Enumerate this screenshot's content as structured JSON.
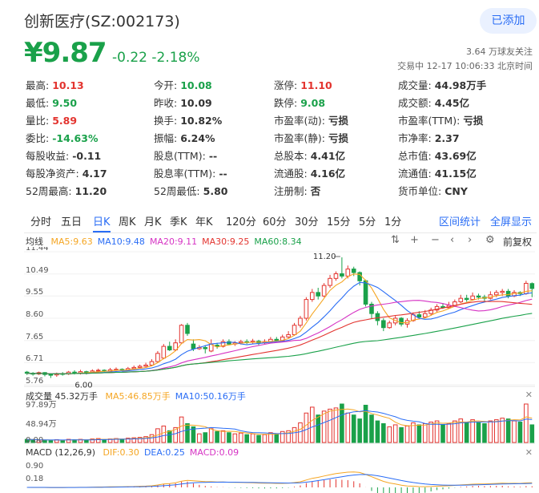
{
  "header": {
    "title": "创新医疗(SZ:002173)",
    "added_label": "已添加",
    "price": "¥9.87",
    "change": "-0.22 -2.18%",
    "followers": "3.64 万球友关注",
    "trading_status": "交易中 12-17 10:06:33 北京时间"
  },
  "quote": [
    [
      {
        "label": "最高:",
        "value": "10.13",
        "color": "red"
      },
      {
        "label": "今开:",
        "value": "10.08",
        "color": "green"
      },
      {
        "label": "涨停:",
        "value": "11.10",
        "color": "red"
      },
      {
        "label": "成交量:",
        "value": "44.98万手",
        "color": ""
      }
    ],
    [
      {
        "label": "最低:",
        "value": "9.50",
        "color": "green"
      },
      {
        "label": "昨收:",
        "value": "10.09",
        "color": ""
      },
      {
        "label": "跌停:",
        "value": "9.08",
        "color": "green"
      },
      {
        "label": "成交额:",
        "value": "4.45亿",
        "color": ""
      }
    ],
    [
      {
        "label": "量比:",
        "value": "5.89",
        "color": "red"
      },
      {
        "label": "换手:",
        "value": "10.82%",
        "color": ""
      },
      {
        "label": "市盈率(动):",
        "value": "亏损",
        "color": ""
      },
      {
        "label": "市盈率(TTM):",
        "value": "亏损",
        "color": ""
      }
    ],
    [
      {
        "label": "委比:",
        "value": "-14.63%",
        "color": "green"
      },
      {
        "label": "振幅:",
        "value": "6.24%",
        "color": ""
      },
      {
        "label": "市盈率(静):",
        "value": "亏损",
        "color": ""
      },
      {
        "label": "市净率:",
        "value": "2.37",
        "color": ""
      }
    ],
    [
      {
        "label": "每股收益:",
        "value": "-0.11",
        "color": ""
      },
      {
        "label": "股息(TTM):",
        "value": "--",
        "color": ""
      },
      {
        "label": "总股本:",
        "value": "4.41亿",
        "color": ""
      },
      {
        "label": "总市值:",
        "value": "43.69亿",
        "color": ""
      }
    ],
    [
      {
        "label": "每股净资产:",
        "value": "4.17",
        "color": ""
      },
      {
        "label": "股息率(TTM):",
        "value": "--",
        "color": ""
      },
      {
        "label": "流通股:",
        "value": "4.16亿",
        "color": ""
      },
      {
        "label": "流通值:",
        "value": "41.15亿",
        "color": ""
      }
    ],
    [
      {
        "label": "52周最高:",
        "value": "11.20",
        "color": ""
      },
      {
        "label": "52周最低:",
        "value": "5.80",
        "color": ""
      },
      {
        "label": "注册制:",
        "value": "否",
        "color": ""
      },
      {
        "label": "货币单位:",
        "value": "CNY",
        "color": ""
      }
    ]
  ],
  "tabs": [
    "分时",
    "五日",
    "日K",
    "周K",
    "月K",
    "季K",
    "年K",
    "120分",
    "60分",
    "30分",
    "15分",
    "5分",
    "1分"
  ],
  "active_tab": "日K",
  "tab_links": {
    "range_stats": "区间统计",
    "fullscreen": "全屏显示"
  },
  "kline": {
    "legend_title": "均线",
    "ma": [
      {
        "label": "MA5:9.63",
        "color": "#f5a623"
      },
      {
        "label": "MA10:9.48",
        "color": "#2a6df5"
      },
      {
        "label": "MA20:9.11",
        "color": "#d633c4"
      },
      {
        "label": "MA30:9.25",
        "color": "#e3342f"
      },
      {
        "label": "MA60:8.34",
        "color": "#1aa14a"
      }
    ],
    "restore_label": "前复权",
    "y_ticks": [
      "11.44",
      "10.49",
      "9.55",
      "8.60",
      "7.65",
      "6.71",
      "5.76"
    ],
    "y_tick_values": [
      11.44,
      10.49,
      9.55,
      8.6,
      7.65,
      6.71,
      5.76
    ],
    "high_label": "11.20",
    "low_label": "6.00"
  },
  "volume": {
    "title": "成交量 45.32万手",
    "ma": [
      {
        "label": "MA5:46.85万手",
        "color": "#f5a623"
      },
      {
        "label": "MA10:50.16万手",
        "color": "#2a6df5"
      }
    ],
    "y_ticks": [
      "97.89万",
      "48.94万",
      "0.00"
    ]
  },
  "macd": {
    "title": "MACD (12,26,9)",
    "items": [
      {
        "label": "DIF:0.30",
        "color": "#f5a623"
      },
      {
        "label": "DEA:0.25",
        "color": "#2a6df5"
      },
      {
        "label": "MACD:0.09",
        "color": "#d633c4"
      }
    ],
    "y_ticks": [
      "0.90",
      "0.18"
    ]
  },
  "colors": {
    "up": "#e3342f",
    "down": "#1aa14a",
    "accent": "#2a6df5"
  },
  "chart_data": {
    "type": "candlestick",
    "y_range": [
      5.76,
      11.44
    ],
    "candles": [
      [
        6.3,
        6.25,
        6.35,
        6.18
      ],
      [
        6.25,
        6.22,
        6.3,
        6.15
      ],
      [
        6.22,
        6.28,
        6.32,
        6.18
      ],
      [
        6.28,
        6.2,
        6.3,
        6.12
      ],
      [
        6.2,
        6.18,
        6.25,
        6.05
      ],
      [
        6.18,
        6.24,
        6.28,
        6.1
      ],
      [
        6.24,
        6.22,
        6.3,
        6.15
      ],
      [
        6.22,
        6.3,
        6.35,
        6.18
      ],
      [
        6.3,
        6.25,
        6.38,
        6.2
      ],
      [
        6.25,
        6.32,
        6.4,
        6.2
      ],
      [
        6.32,
        6.28,
        6.36,
        6.2
      ],
      [
        6.28,
        6.35,
        6.42,
        6.25
      ],
      [
        6.35,
        6.38,
        6.45,
        6.3
      ],
      [
        6.38,
        6.34,
        6.42,
        6.28
      ],
      [
        6.34,
        6.4,
        6.48,
        6.3
      ],
      [
        6.4,
        6.42,
        6.5,
        6.35
      ],
      [
        6.42,
        6.38,
        6.46,
        6.32
      ],
      [
        6.38,
        6.45,
        6.52,
        6.34
      ],
      [
        6.45,
        6.5,
        6.58,
        6.4
      ],
      [
        6.5,
        6.55,
        6.62,
        6.45
      ],
      [
        6.55,
        6.6,
        6.7,
        6.5
      ],
      [
        6.6,
        6.75,
        6.85,
        6.55
      ],
      [
        6.75,
        7.1,
        7.2,
        6.7
      ],
      [
        6.9,
        7.4,
        7.5,
        6.85
      ],
      [
        7.4,
        7.25,
        7.6,
        7.2
      ],
      [
        7.25,
        7.55,
        7.7,
        7.2
      ],
      [
        7.55,
        8.3,
        8.35,
        7.5
      ],
      [
        8.3,
        7.95,
        8.4,
        7.85
      ],
      [
        7.5,
        7.3,
        7.7,
        7.2
      ],
      [
        7.3,
        7.35,
        7.45,
        7.25
      ],
      [
        7.35,
        7.3,
        7.45,
        7.1
      ],
      [
        7.2,
        7.5,
        7.7,
        7.15
      ],
      [
        7.45,
        7.4,
        7.55,
        7.3
      ],
      [
        7.4,
        7.6,
        7.7,
        7.35
      ],
      [
        7.6,
        7.5,
        7.7,
        7.45
      ],
      [
        7.5,
        7.55,
        7.62,
        7.42
      ],
      [
        7.55,
        7.6,
        7.68,
        7.48
      ],
      [
        7.6,
        7.58,
        7.7,
        7.5
      ],
      [
        7.58,
        7.62,
        7.72,
        7.5
      ],
      [
        7.62,
        7.55,
        7.68,
        7.45
      ],
      [
        7.55,
        7.6,
        7.7,
        7.5
      ],
      [
        7.6,
        7.7,
        7.8,
        7.55
      ],
      [
        7.7,
        7.65,
        7.8,
        7.58
      ],
      [
        7.65,
        7.8,
        7.9,
        7.6
      ],
      [
        7.8,
        7.9,
        8.05,
        7.75
      ],
      [
        7.9,
        8.3,
        8.4,
        7.85
      ],
      [
        8.3,
        8.6,
        8.7,
        8.2
      ],
      [
        8.6,
        9.4,
        9.5,
        8.5
      ],
      [
        9.4,
        9.7,
        9.85,
        9.3
      ],
      [
        9.7,
        9.55,
        9.9,
        9.4
      ],
      [
        9.55,
        10.0,
        10.1,
        9.5
      ],
      [
        10.0,
        10.3,
        10.45,
        9.9
      ],
      [
        10.3,
        10.5,
        10.6,
        10.2
      ],
      [
        10.5,
        10.4,
        11.2,
        10.3
      ],
      [
        10.4,
        10.7,
        10.85,
        10.3
      ],
      [
        10.7,
        10.55,
        10.8,
        10.4
      ],
      [
        10.55,
        10.2,
        10.6,
        10.0
      ],
      [
        10.2,
        9.2,
        10.25,
        9.1
      ],
      [
        9.2,
        8.8,
        9.3,
        8.6
      ],
      [
        8.8,
        8.5,
        8.9,
        8.3
      ],
      [
        8.5,
        8.2,
        8.6,
        8.05
      ],
      [
        8.2,
        8.4,
        8.5,
        8.15
      ],
      [
        8.4,
        8.6,
        8.7,
        8.3
      ],
      [
        8.6,
        8.35,
        8.65,
        8.25
      ],
      [
        8.35,
        8.5,
        8.6,
        8.2
      ],
      [
        8.5,
        8.75,
        8.85,
        8.45
      ],
      [
        8.75,
        8.65,
        8.9,
        8.6
      ],
      [
        8.65,
        8.8,
        8.95,
        8.6
      ],
      [
        8.8,
        8.95,
        9.05,
        8.7
      ],
      [
        8.95,
        9.1,
        9.2,
        8.85
      ],
      [
        9.1,
        9.05,
        9.25,
        9.0
      ],
      [
        9.05,
        9.15,
        9.3,
        9.0
      ],
      [
        9.15,
        9.3,
        9.4,
        9.1
      ],
      [
        9.3,
        9.45,
        9.6,
        9.25
      ],
      [
        9.45,
        9.4,
        9.6,
        9.3
      ],
      [
        9.4,
        9.55,
        9.7,
        9.35
      ],
      [
        9.55,
        9.5,
        9.65,
        9.4
      ],
      [
        9.5,
        9.45,
        9.6,
        9.3
      ],
      [
        9.45,
        9.6,
        9.75,
        9.4
      ],
      [
        9.6,
        9.7,
        9.8,
        9.5
      ],
      [
        9.7,
        9.75,
        9.85,
        9.55
      ],
      [
        9.75,
        9.55,
        9.85,
        9.45
      ],
      [
        9.55,
        9.7,
        9.8,
        9.5
      ],
      [
        9.7,
        9.65,
        9.75,
        9.55
      ],
      [
        9.65,
        10.09,
        10.2,
        9.6
      ],
      [
        10.08,
        9.87,
        10.13,
        9.5
      ]
    ],
    "volumes": [
      8,
      7,
      6,
      6,
      5,
      7,
      6,
      8,
      7,
      8,
      6,
      9,
      10,
      8,
      9,
      10,
      8,
      11,
      12,
      13,
      15,
      20,
      35,
      42,
      30,
      38,
      65,
      48,
      40,
      22,
      25,
      35,
      28,
      30,
      25,
      22,
      24,
      20,
      22,
      18,
      20,
      25,
      22,
      28,
      30,
      38,
      50,
      75,
      90,
      70,
      80,
      85,
      88,
      98,
      75,
      70,
      60,
      95,
      70,
      55,
      48,
      40,
      45,
      38,
      42,
      50,
      45,
      48,
      52,
      55,
      45,
      48,
      55,
      60,
      52,
      58,
      50,
      48,
      55,
      58,
      62,
      60,
      55,
      52,
      98,
      45
    ]
  }
}
